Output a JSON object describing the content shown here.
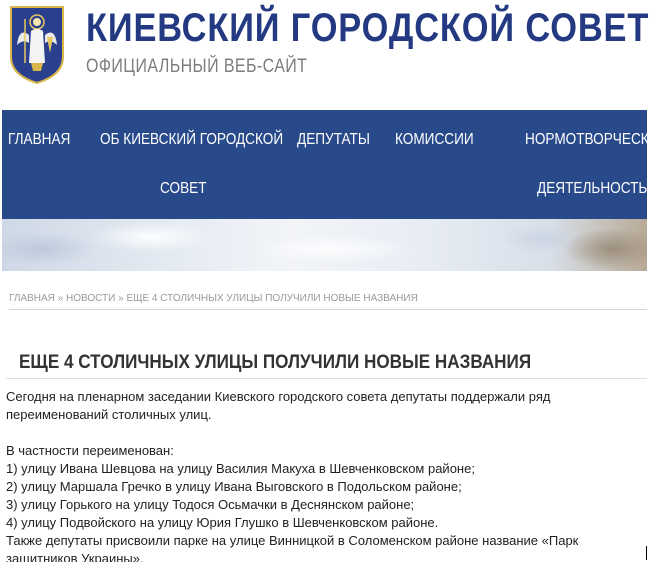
{
  "header": {
    "title": "КИЕВСКИЙ ГОРОДСКОЙ СОВЕТ",
    "subtitle": "ОФИЦИАЛЬНЫЙ ВЕБ-САЙТ",
    "logo_icon": "kyiv-coat-of-arms-icon"
  },
  "colors": {
    "brand": "#233a82",
    "nav_bg": "#294a8a",
    "nav_text": "#ffffff"
  },
  "nav": {
    "home": "ГЛАВНАЯ",
    "about_line1": "ОБ КИЕВСКИЙ ГОРОДСКОЙ",
    "about_line2": "СОВЕТ",
    "deputies": "ДЕПУТАТЫ",
    "commissions": "КОМИССИИ",
    "lawmaking_line1": "НОРМОТВОРЧЕСКАЯ",
    "lawmaking_line2": "ДЕЯТЕЛЬНОСТЬ"
  },
  "breadcrumb": {
    "home": "ГЛАВНАЯ",
    "separator": " » ",
    "news": "НОВОСТИ",
    "current": "ЕЩЕ 4 СТОЛИЧНЫХ УЛИЦЫ ПОЛУЧИЛИ НОВЫЕ НАЗВАНИЯ"
  },
  "article": {
    "title": "ЕЩЕ 4 СТОЛИЧНЫХ УЛИЦЫ ПОЛУЧИЛИ НОВЫЕ НАЗВАНИЯ",
    "intro": "Сегодня на пленарном заседании Киевского городского совета депутаты поддержали ряд переименований столичных улиц.",
    "list_heading": "В частности переименован:",
    "items": [
      "1) улицу Ивана Шевцова на улицу Василия Макуха в Шевченковском районе;",
      "2) улицу Маршала Гречко в улицу Ивана Выговского в Подольском районе;",
      "3) улицу Горького на улицу Тодося Осьмачки в Деснянском районе;",
      "4) улицу Подвойского на улицу Юрия Глушко в Шевченковском районе."
    ],
    "closing": "Также депутаты присвоили парке на улице Винницкой в Соломенском районе название «Парк защитников Украины»."
  }
}
